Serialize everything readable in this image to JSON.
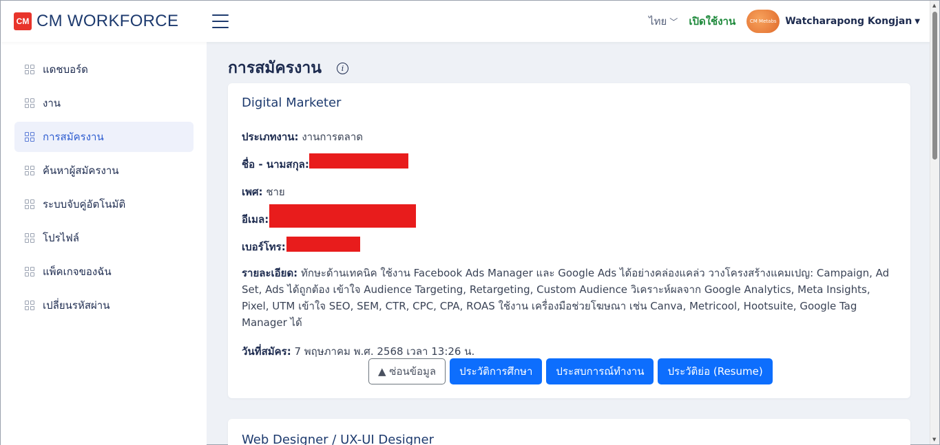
{
  "header": {
    "logo_mark": "CM",
    "logo_text": "CM WORKFORCE",
    "language": "ไทย",
    "activate_label": "เปิดใช้งาน",
    "avatar_text": "CM Metabs",
    "username": "Watcharapong Kongjan"
  },
  "sidebar": {
    "items": [
      {
        "label": "แดชบอร์ด"
      },
      {
        "label": "งาน"
      },
      {
        "label": "การสมัครงาน"
      },
      {
        "label": "ค้นหาผู้สมัครงาน"
      },
      {
        "label": "ระบบจับคู่อัตโนมัติ"
      },
      {
        "label": "โปรไฟล์"
      },
      {
        "label": "แพ็คเกจของฉัน"
      },
      {
        "label": "เปลี่ยนรหัสผ่าน"
      }
    ],
    "active_index": 2
  },
  "main": {
    "page_title": "การสมัครงาน",
    "applications": [
      {
        "job_title": "Digital Marketer",
        "job_type_label": "ประเภทงาน:",
        "job_type": "งานการตลาด",
        "name_label": "ชื่อ - นามสกุล:",
        "gender_label": "เพศ:",
        "gender": "ชาย",
        "email_label": "อีเมล:",
        "phone_label": "เบอร์โทร:",
        "details_label": "รายละเอียด:",
        "details": "ทักษะด้านเทคนิค ใช้งาน Facebook Ads Manager และ Google Ads ได้อย่างคล่องแคล่ว วางโครงสร้างแคมเปญ: Campaign, Ad Set, Ads ได้ถูกต้อง เข้าใจ Audience Targeting, Retargeting, Custom Audience วิเคราะห์ผลจาก Google Analytics, Meta Insights, Pixel, UTM เข้าใจ SEO, SEM, CTR, CPC, CPA, ROAS ใช้งาน เครื่องมือช่วยโฆษณา เช่น Canva, Metricool, Hootsuite, Google Tag Manager ได้",
        "applied_date_label": "วันที่สมัคร:",
        "applied_date": "7 พฤษภาคม พ.ศ. 2568 เวลา 13:26 น.",
        "buttons": {
          "hide": "▲ ซ่อนข้อมูล",
          "education": "ประวัติการศึกษา",
          "experience": "ประสบการณ์ทำงาน",
          "resume": "ประวัติย่อ (Resume)"
        }
      },
      {
        "job_title": "Web Designer / UX-UI Designer"
      }
    ]
  },
  "colors": {
    "primary": "#0d6efd",
    "redaction": "#e81c1c",
    "activate": "#1f8a3c",
    "brand": "#e8342b"
  }
}
